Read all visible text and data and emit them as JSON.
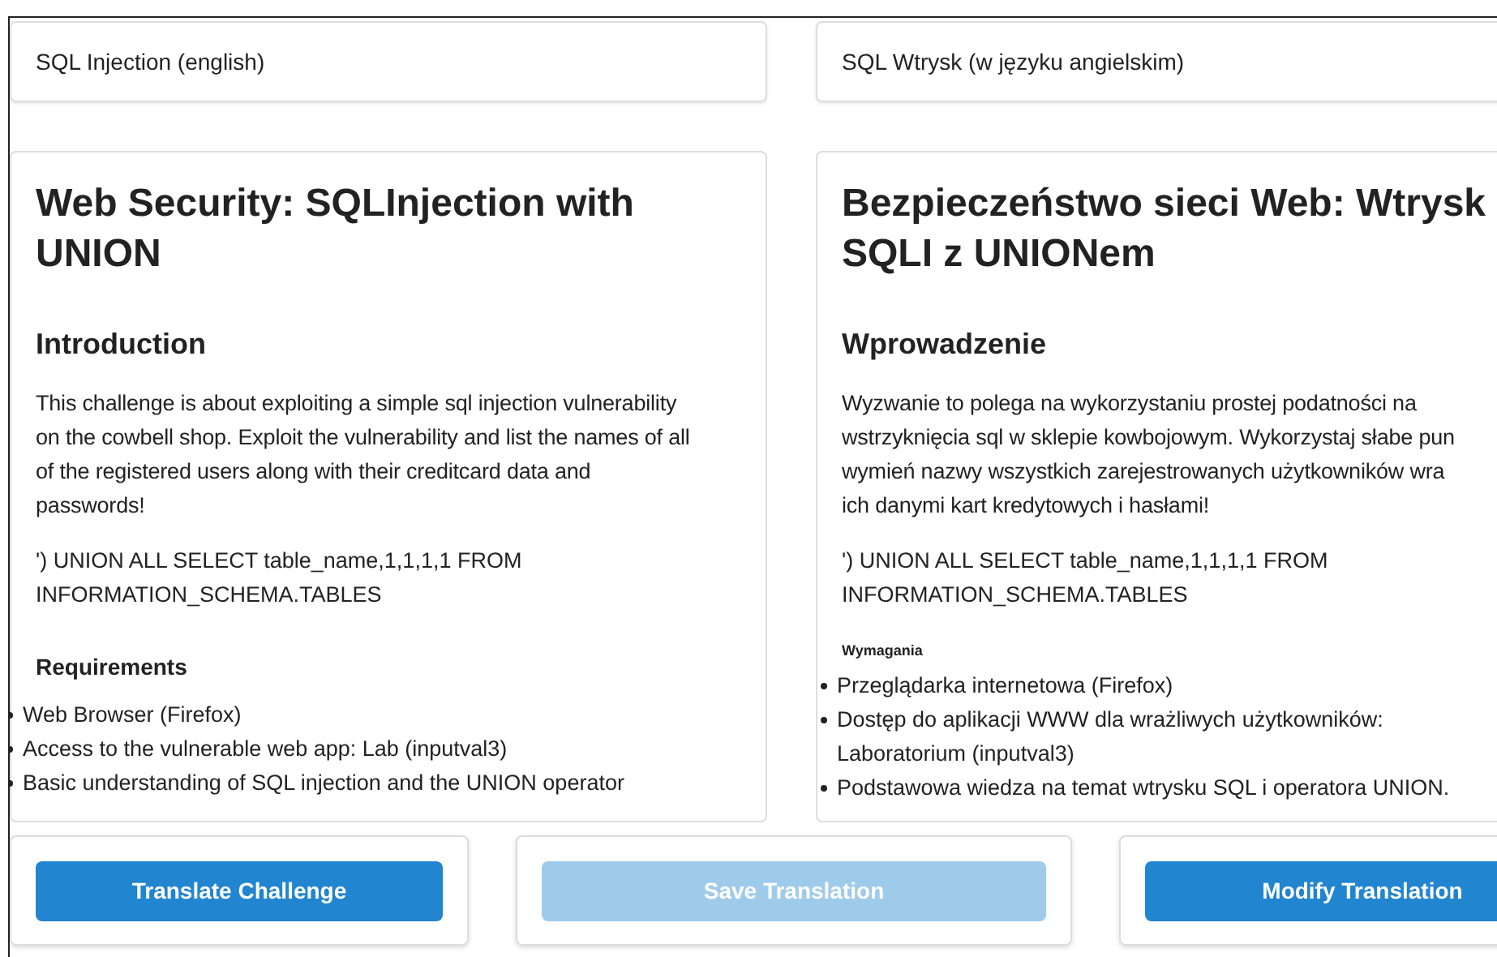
{
  "columns": [
    {
      "label": "SQL Injection (english)",
      "title": "Web Security: SQLInjection with UNION",
      "intro_heading": "Introduction",
      "intro_lines": [
        "This challenge is about exploiting a simple sql injection vulnerability",
        "on the cowbell shop. Exploit the vulnerability and list the names of all",
        "of the registered users along with their creditcard data and",
        "passwords!"
      ],
      "query_lines": [
        "') UNION ALL SELECT table_name,1,1,1,1 FROM",
        "INFORMATION_SCHEMA.TABLES"
      ],
      "requirements_heading": {
        "text": "Requirements",
        "kind": "normal"
      },
      "requirements": [
        [
          "Web Browser (Firefox)"
        ],
        [
          "Access to the vulnerable web app: Lab (inputval3)"
        ],
        [
          "Basic understanding of SQL injection and the UNION operator"
        ]
      ]
    },
    {
      "label": "SQL Wtrysk (w języku angielskim)",
      "title": "Bezpieczeństwo sieci Web: Wtrysk SQLI z UNIONem",
      "intro_heading": "Wprowadzenie",
      "intro_lines": [
        "Wyzwanie to polega na wykorzystaniu prostej podatności na",
        "wstrzyknięcia sql w sklepie kowbojowym. Wykorzystaj słabe pun",
        "wymień nazwy wszystkich zarejestrowanych użytkowników wra",
        "ich danymi kart kredytowych i hasłami!"
      ],
      "query_lines": [
        "') UNION ALL SELECT table_name,1,1,1,1 FROM",
        "INFORMATION_SCHEMA.TABLES"
      ],
      "requirements_heading": {
        "text": "Wymagania",
        "kind": "small"
      },
      "requirements": [
        [
          "Przeglądarka internetowa (Firefox)"
        ],
        [
          "Dostęp do aplikacji WWW dla wrażliwych użytkowników:",
          "Laboratorium (inputval3)"
        ],
        [
          "Podstawowa wiedza na temat wtrysku SQL i operatora UNION."
        ]
      ]
    }
  ],
  "buttons": [
    {
      "label": "Translate Challenge",
      "disabled": false
    },
    {
      "label": "Save Translation",
      "disabled": true
    },
    {
      "label": "Modify Translation",
      "disabled": false
    }
  ]
}
